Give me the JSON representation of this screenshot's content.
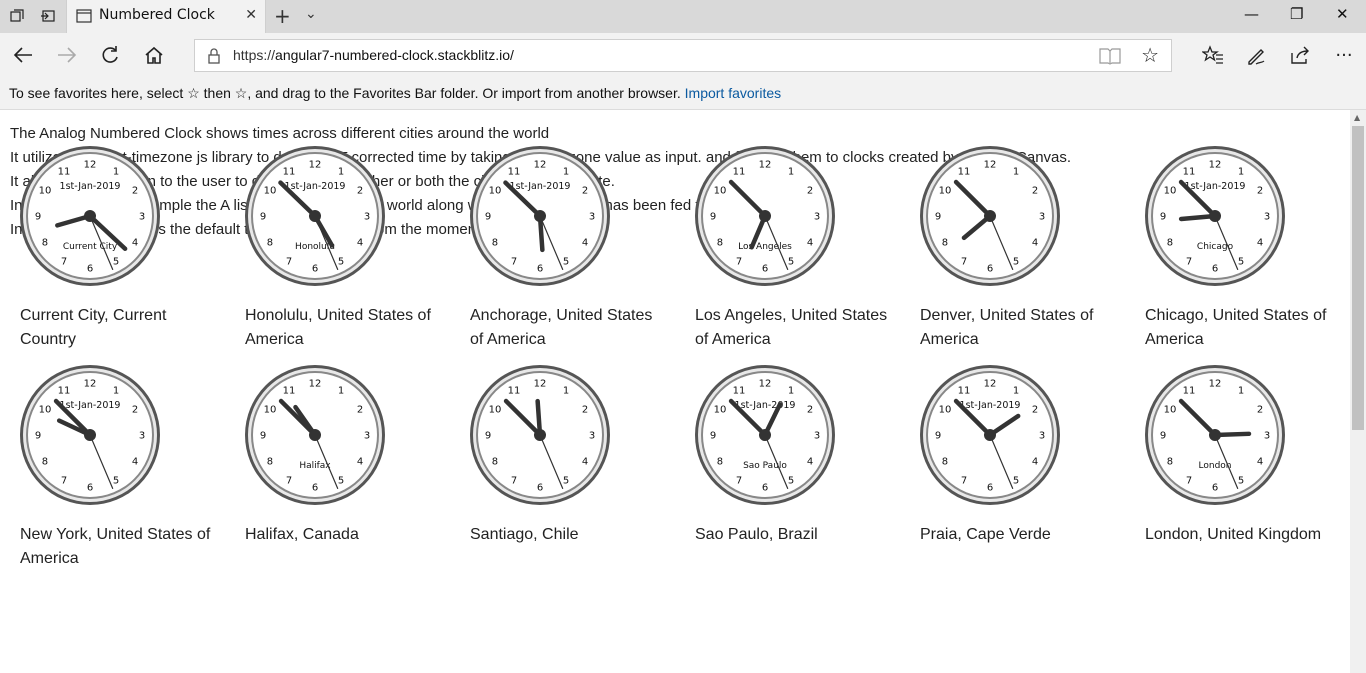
{
  "browser": {
    "tab_title": "Numbered Clock",
    "url_scheme": "https://",
    "url_host": "angular7-numbered-clock.stackblitz.io/",
    "favorites_text": "To see favorites here, select ☆ then ☆, and drag to the Favorites Bar folder. Or import from another browser.",
    "favorites_link": "Import favorites"
  },
  "intro": [
    "The Analog Numbered Clock shows times across different cities around the world",
    "It utilizes moment-timezone js library to depict DST corrected time by taking the timezone value as input. and feeding them to clocks created by HTML5 Canvas.",
    "It also provides option to the user to display neither, either or both the city's name and date.",
    "In the given below example the A list of cities around the world along with their timezones has been fed to the component.",
    "In the first clock, it uses the default time and Location from the moment.js timezone."
  ],
  "clock_numbers": [
    "12",
    "1",
    "2",
    "3",
    "4",
    "5",
    "6",
    "7",
    "8",
    "9",
    "10",
    "11"
  ],
  "clocks": [
    {
      "caption": "Current City, Current Country",
      "date": "1st-Jan-2019",
      "city": "Current City",
      "hour_hand_deg": 254,
      "minute_hand_deg": 133,
      "second_hand_deg": 157
    },
    {
      "caption": "Honolulu, United States of America",
      "date": "1st-Jan-2019",
      "city": "Honolulu",
      "hour_hand_deg": 150,
      "minute_hand_deg": 314,
      "second_hand_deg": 157
    },
    {
      "caption": "Anchorage, United States of America",
      "date": "1st-Jan-2019",
      "city": "",
      "hour_hand_deg": 176,
      "minute_hand_deg": 314,
      "second_hand_deg": 157
    },
    {
      "caption": "Los Angeles, United States of America",
      "date": "",
      "city": "Los Angeles",
      "hour_hand_deg": 203,
      "minute_hand_deg": 315,
      "second_hand_deg": 157
    },
    {
      "caption": "Denver, United States of America",
      "date": "",
      "city": "",
      "hour_hand_deg": 230,
      "minute_hand_deg": 315,
      "second_hand_deg": 157
    },
    {
      "caption": "Chicago, United States of America",
      "date": "1st-Jan-2019",
      "city": "Chicago",
      "hour_hand_deg": 265,
      "minute_hand_deg": 315,
      "second_hand_deg": 157
    },
    {
      "caption": "New York, United States of America",
      "date": "1st-Jan-2019",
      "city": "",
      "hour_hand_deg": 295,
      "minute_hand_deg": 315,
      "second_hand_deg": 157
    },
    {
      "caption": "Halifax, Canada",
      "date": "",
      "city": "Halifax",
      "hour_hand_deg": 325,
      "minute_hand_deg": 315,
      "second_hand_deg": 157
    },
    {
      "caption": "Santiago, Chile",
      "date": "",
      "city": "",
      "hour_hand_deg": 356,
      "minute_hand_deg": 315,
      "second_hand_deg": 157
    },
    {
      "caption": "Sao Paulo, Brazil",
      "date": "1st-Jan-2019",
      "city": "Sao Paulo",
      "hour_hand_deg": 26,
      "minute_hand_deg": 315,
      "second_hand_deg": 157
    },
    {
      "caption": "Praia, Cape Verde",
      "date": "1st-Jan-2019",
      "city": "",
      "hour_hand_deg": 56,
      "minute_hand_deg": 315,
      "second_hand_deg": 157
    },
    {
      "caption": "London, United Kingdom",
      "date": "",
      "city": "London",
      "hour_hand_deg": 88,
      "minute_hand_deg": 315,
      "second_hand_deg": 157
    }
  ],
  "colors": {
    "hand": "#333333",
    "ring_dark": "#555555",
    "ring_light": "#e8e8e8",
    "link": "#0b5aa0"
  }
}
